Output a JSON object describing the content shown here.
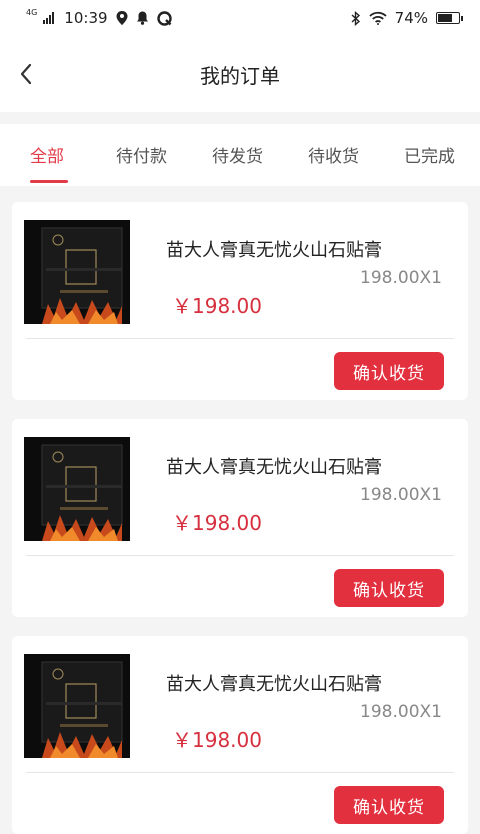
{
  "status_bar": {
    "time": "10:39",
    "network": "4G",
    "battery_pct": "74%",
    "battery_level": 0.74
  },
  "header": {
    "title": "我的订单",
    "back_icon": "chevron-left-icon"
  },
  "tabs": [
    {
      "label": "全部",
      "active": true
    },
    {
      "label": "待付款",
      "active": false
    },
    {
      "label": "待发货",
      "active": false
    },
    {
      "label": "待收货",
      "active": false
    },
    {
      "label": "已完成",
      "active": false
    }
  ],
  "colors": {
    "accent": "#e23b49",
    "button": "#e3303f",
    "price": "#d62f3d"
  },
  "orders": [
    {
      "name": "苗大人膏真无忧火山石贴膏",
      "qty": "198.00X1",
      "price": "￥198.00",
      "action": "确认收货"
    },
    {
      "name": "苗大人膏真无忧火山石贴膏",
      "qty": "198.00X1",
      "price": "￥198.00",
      "action": "确认收货"
    },
    {
      "name": "苗大人膏真无忧火山石贴膏",
      "qty": "198.00X1",
      "price": "￥198.00",
      "action": "确认收货"
    }
  ]
}
